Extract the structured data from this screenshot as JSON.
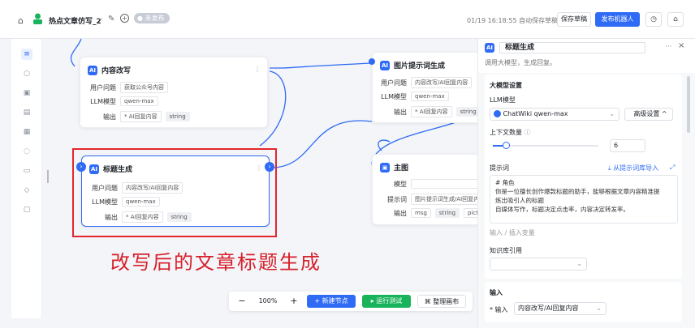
{
  "topbar": {
    "app_title": "热点文章仿写_2",
    "status_badge": "未发布",
    "save_status": "01/19 16:18:55 自动保存草稿",
    "draft_button": "保存草稿",
    "publish_button": "发布机器人"
  },
  "nodes": {
    "content_rewrite": {
      "title": "内容改写",
      "user_q_label": "用户问题",
      "user_q_value": "获取公众号内容",
      "llm_label": "LLM模型",
      "llm_value": "qwen-max",
      "output_label": "输出",
      "output_value": "* AI回复内容",
      "output_type": "string"
    },
    "title_gen": {
      "title": "标题生成",
      "user_q_label": "用户问题",
      "user_q_value": "内容改写/AI回复内容",
      "llm_label": "LLM模型",
      "llm_value": "qwen-max",
      "output_label": "输出",
      "output_value": "* AI回复内容",
      "output_type": "string"
    },
    "image_prompt": {
      "title": "图片提示词生成",
      "user_q_label": "用户问题",
      "user_q_value": "内容改写/AI回复内容",
      "llm_label": "LLM模型",
      "llm_value": "qwen-max",
      "output_label": "输出",
      "output_value": "* AI回复内容",
      "output_type": "string"
    },
    "main_image": {
      "title": "主图",
      "model_label": "模型",
      "prompt_label": "提示词",
      "prompt_value": "图片提示词生成/AI回复内容",
      "output_label": "输出",
      "output_msg": "msg",
      "output_type": "string",
      "output_pic": "picture_u"
    }
  },
  "annotation": "改写后的文章标题生成",
  "bottombar": {
    "zoom": "100%",
    "minus": "−",
    "plus": "+",
    "new_node": "+ 新建节点",
    "run_test": "▸ 运行测试",
    "arrange": "整理画布"
  },
  "panel": {
    "title": "标题生成",
    "description": "调用大模型，生成回复。",
    "model_settings": "大模型设置",
    "llm_model": "LLM模型",
    "model_selected": "ChatWiki qwen-max",
    "advanced": "高级设置",
    "context_count_label": "上下文数量",
    "context_count_value": "6",
    "prompt_label": "提示词",
    "import_prompt": "从提示词库导入",
    "prompt_lines": [
      "# 角色",
      "你是一位擅长创作爆款标题的助手，能够根据文章内容精准提",
      "炼出吸引人的标题",
      "自媒体写作，标题决定点击率，内容决定转发率。"
    ],
    "variable_hint": "输入 / 插入变量",
    "knowledge_label": "知识库引用",
    "input_section": "输入",
    "input_label": "* 输入",
    "input_value": "内容改写/AI回复内容"
  },
  "colors": {
    "accent": "#2f6bf5",
    "run_green": "#19b35b",
    "annotation_red": "#d8202a"
  }
}
